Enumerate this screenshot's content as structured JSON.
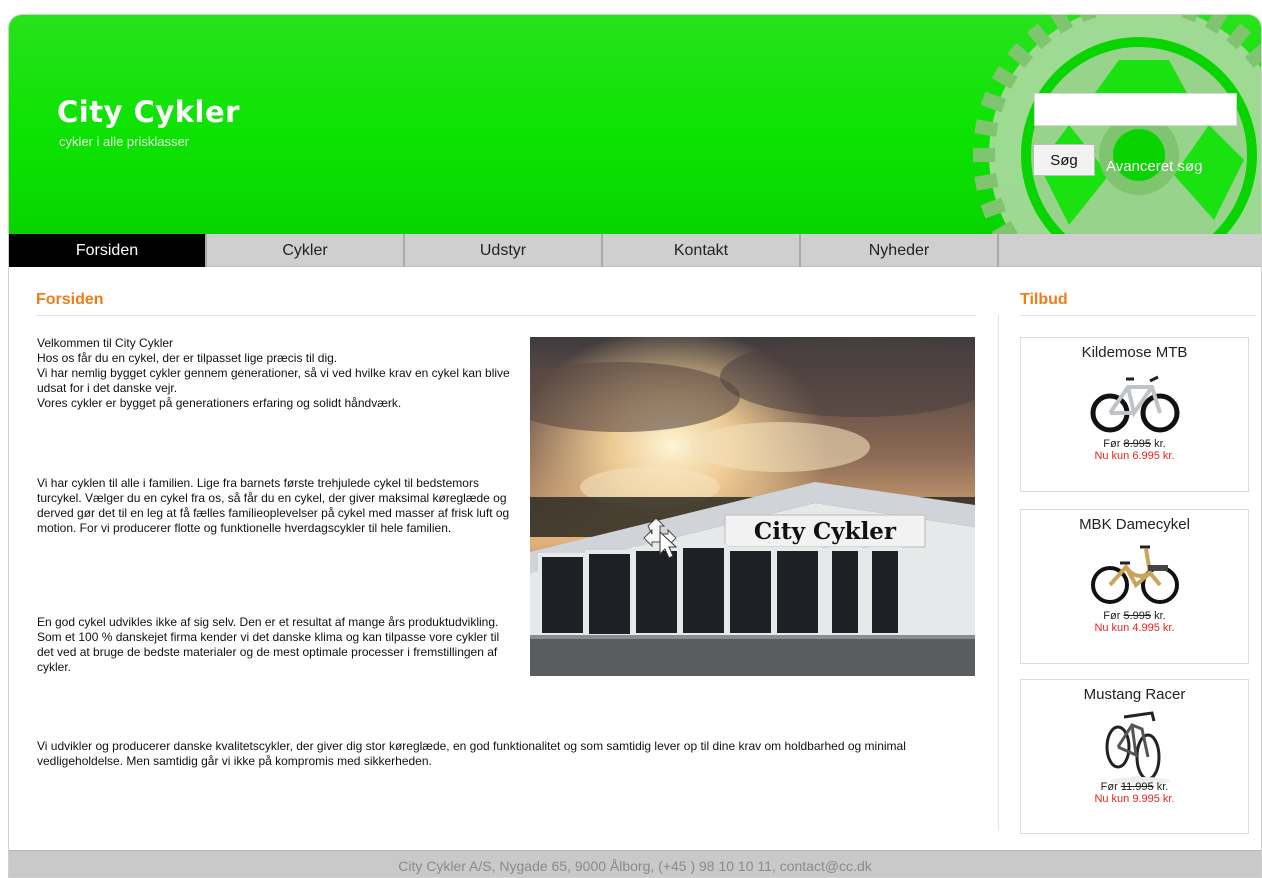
{
  "header": {
    "title": "City Cykler",
    "tagline": "cykler i alle prisklasser",
    "search_placeholder": "",
    "search_button": "Søg",
    "advanced_search": "Avanceret søg",
    "colors": {
      "header_green": "#0ce302",
      "accent_orange": "#f07c19",
      "price_red": "#e8231d"
    }
  },
  "nav": {
    "items": [
      "Forsiden",
      "Cykler",
      "Udstyr",
      "Kontakt",
      "Nyheder"
    ],
    "active": "Forsiden"
  },
  "main": {
    "title": "Forsiden",
    "paragraphs": [
      "Velkommen til City Cykler\nHos os får du en cykel, der er tilpasset lige præcis til dig.\nVi har nemlig bygget cykler gennem generationer, så vi ved hvilke krav en cykel kan blive udsat for i det danske vejr.\nVores cykler er bygget på generationers erfaring og solidt håndværk.",
      "Vi har cyklen til alle i familien. Lige fra barnets første trehjulede cykel til bedstemors turcykel. Vælger du en cykel fra os, så får du en cykel, der giver maksimal køreglæde og derved gør det til en leg at få fælles familieoplevelser på cykel med masser af frisk luft og motion. For vi producerer flotte og funktionelle hverdagscykler til hele familien.",
      "En god cykel udvikles ikke af sig selv. Den er et resultat af mange års produktudvikling. Som et 100 % danskejet firma kender vi det danske klima og kan tilpasse vore cykler til det ved at bruge de bedste materialer og de mest optimale processer i fremstillingen af cykler.",
      "Vi udvikler og producerer danske kvalitetscykler, der giver dig stor køreglæde, en god funktionalitet og som samtidig lever op til dine krav om holdbarhed og minimal vedligeholdelse. Men samtidig går vi ikke på kompromis med sikkerheden."
    ],
    "photo_sign": "City Cykler"
  },
  "offers": {
    "title": "Tilbud",
    "items": [
      {
        "name": "Kildemose MTB",
        "before_label": "Før",
        "before_price": "8.995",
        "currency": "kr.",
        "now": "Nu kun 6.995 kr."
      },
      {
        "name": "MBK Damecykel",
        "before_label": "Før",
        "before_price": "5.995",
        "currency": "kr.",
        "now": "Nu kun 4.995 kr."
      },
      {
        "name": "Mustang Racer",
        "before_label": "Før",
        "before_price": "11.995",
        "currency": "kr.",
        "now": "Nu kun 9.995 kr."
      }
    ]
  },
  "footer": {
    "text": "City Cykler A/S, Nygade 65, 9000 Ålborg, (+45 ) 98 10 10 11, contact@cc.dk"
  }
}
